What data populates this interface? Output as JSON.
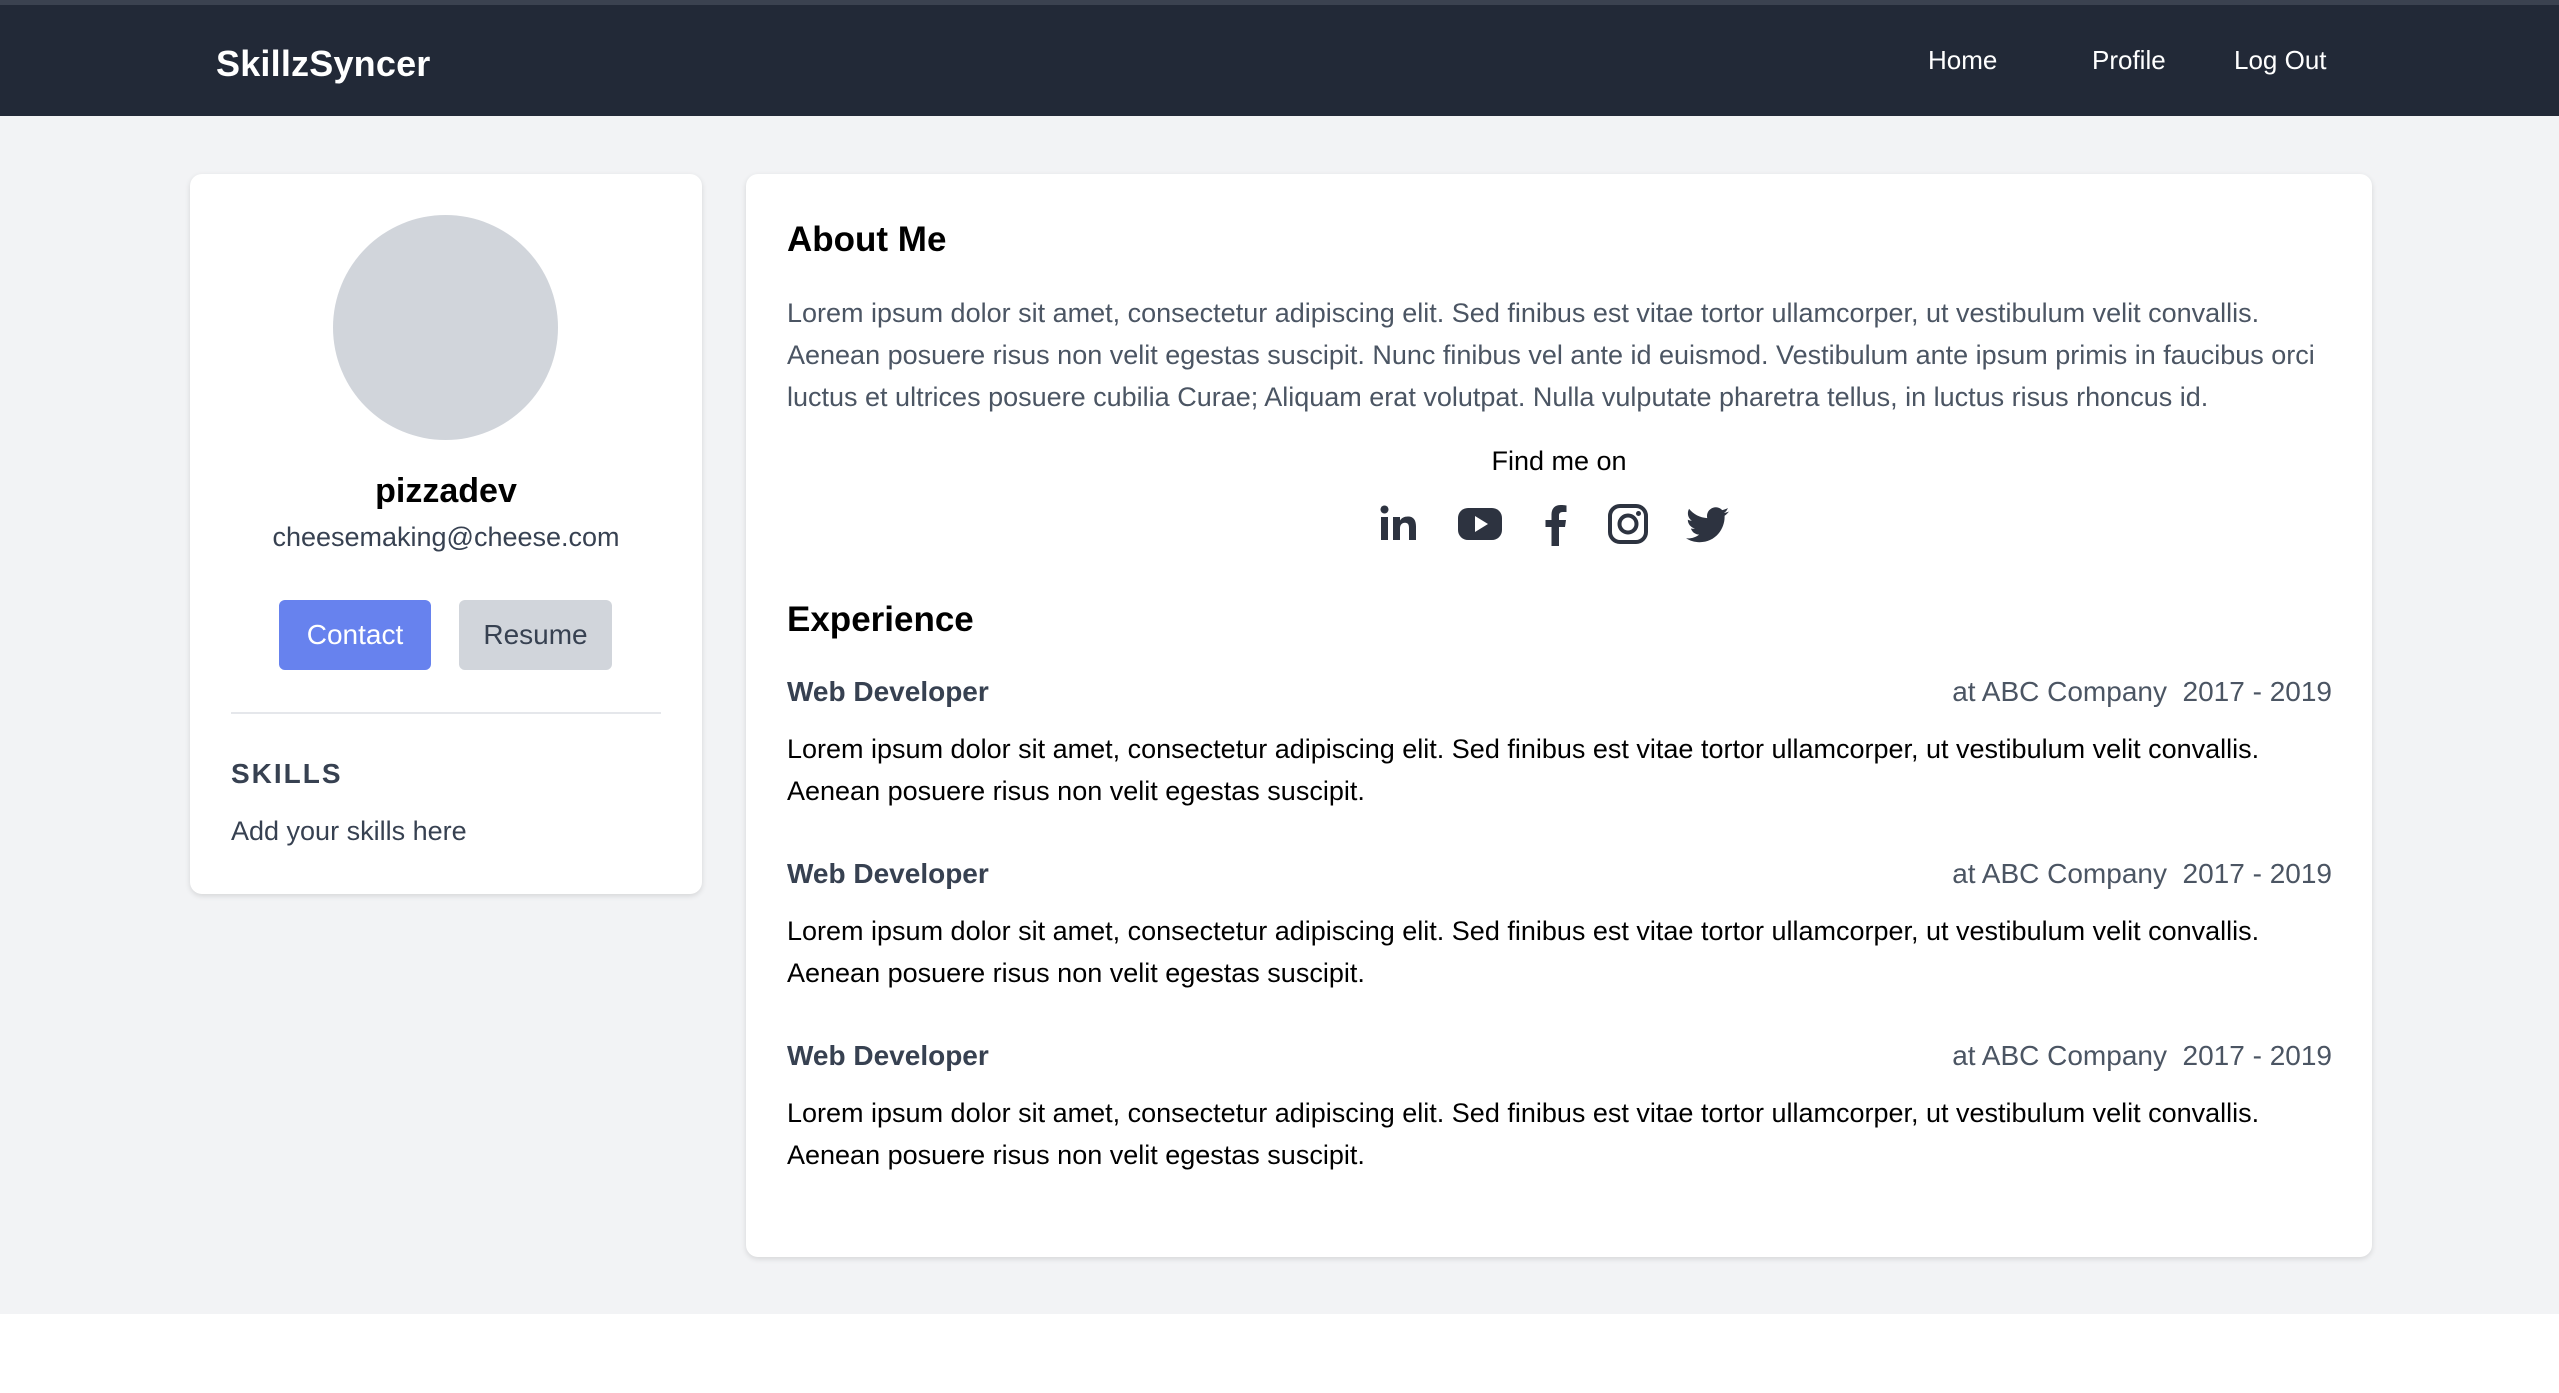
{
  "nav": {
    "brand": "SkillzSyncer",
    "links": [
      "Home",
      "Profile",
      "Log Out"
    ]
  },
  "profile": {
    "username": "pizzadev",
    "email": "cheesemaking@cheese.com",
    "contact_label": "Contact",
    "resume_label": "Resume",
    "skills_title": "SKILLS",
    "skills_placeholder": "Add your skills here"
  },
  "about": {
    "title": "About Me",
    "text": "Lorem ipsum dolor sit amet, consectetur adipiscing elit. Sed finibus est vitae tortor ullamcorper, ut vestibulum velit convallis. Aenean posuere risus non velit egestas suscipit. Nunc finibus vel ante id euismod. Vestibulum ante ipsum primis in faucibus orci luctus et ultrices posuere cubilia Curae; Aliquam erat volutpat. Nulla vulputate pharetra tellus, in luctus risus rhoncus id.",
    "find_me": "Find me on",
    "social_icons": [
      "linkedin-icon",
      "youtube-icon",
      "facebook-icon",
      "instagram-icon",
      "twitter-icon"
    ]
  },
  "experience": {
    "title": "Experience",
    "items": [
      {
        "role": "Web Developer",
        "company": "at ABC Company",
        "years": "2017 - 2019",
        "description": "Lorem ipsum dolor sit amet, consectetur adipiscing elit. Sed finibus est vitae tortor ullamcorper, ut vestibulum velit convallis. Aenean posuere risus non velit egestas suscipit."
      },
      {
        "role": "Web Developer",
        "company": "at ABC Company",
        "years": "2017 - 2019",
        "description": "Lorem ipsum dolor sit amet, consectetur adipiscing elit. Sed finibus est vitae tortor ullamcorper, ut vestibulum velit convallis. Aenean posuere risus non velit egestas suscipit."
      },
      {
        "role": "Web Developer",
        "company": "at ABC Company",
        "years": "2017 - 2019",
        "description": "Lorem ipsum dolor sit amet, consectetur adipiscing elit. Sed finibus est vitae tortor ullamcorper, ut vestibulum velit convallis. Aenean posuere risus non velit egestas suscipit."
      }
    ]
  },
  "colors": {
    "navbar": "#222937",
    "page_bg": "#f2f3f5",
    "primary_button": "#6782ee",
    "secondary_button": "#d1d5db",
    "avatar_placeholder": "#d1d5db",
    "icon": "#2d3340"
  }
}
